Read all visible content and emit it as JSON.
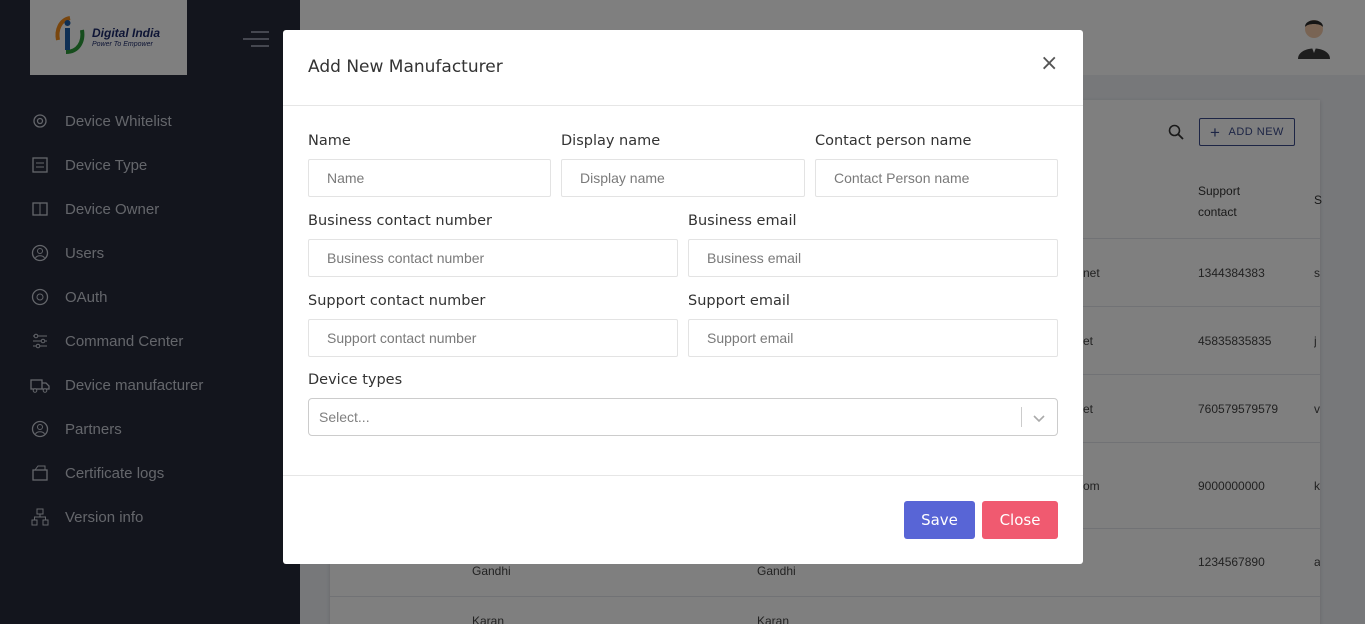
{
  "logo": {
    "title": "Digital India",
    "subtitle": "Power To Empower"
  },
  "sidebar": {
    "items": [
      {
        "label": "Device Whitelist",
        "icon": "gear-icon"
      },
      {
        "label": "Device Type",
        "icon": "list-icon"
      },
      {
        "label": "Device Owner",
        "icon": "book-icon"
      },
      {
        "label": "Users",
        "icon": "user-icon"
      },
      {
        "label": "OAuth",
        "icon": "target-icon"
      },
      {
        "label": "Command Center",
        "icon": "sliders-icon"
      },
      {
        "label": "Device manufacturer",
        "icon": "truck-icon"
      },
      {
        "label": "Partners",
        "icon": "user-icon"
      },
      {
        "label": "Certificate logs",
        "icon": "box-icon"
      },
      {
        "label": "Version info",
        "icon": "network-icon"
      }
    ]
  },
  "toolbar": {
    "add_new_label": "ADD NEW"
  },
  "table": {
    "header_support_line1": "Support",
    "header_support_line2": "contact",
    "header_s": "S",
    "rows": [
      {
        "email_tail": "net",
        "support": "1344384383",
        "next": "s"
      },
      {
        "email_tail": "et",
        "support": "45835835835",
        "next": "j"
      },
      {
        "email_tail": "et",
        "support": "760579579579",
        "next": "v"
      },
      {
        "email_tail": "om",
        "support": "9000000000",
        "next": "k"
      },
      {
        "email_tail": "",
        "support": "1234567890",
        "next": "a",
        "name": "Gandhi",
        "owner": "Gandhi"
      },
      {
        "name": "Karan",
        "owner": "Karan"
      }
    ]
  },
  "modal": {
    "title": "Add New Manufacturer",
    "fields": {
      "name": {
        "label": "Name",
        "placeholder": "Name",
        "value": ""
      },
      "display_name": {
        "label": "Display name",
        "placeholder": "Display name",
        "value": ""
      },
      "contact_person": {
        "label": "Contact person name",
        "placeholder": "Contact Person name",
        "value": ""
      },
      "business_contact": {
        "label": "Business contact number",
        "placeholder": "Business contact number",
        "value": ""
      },
      "business_email": {
        "label": "Business email",
        "placeholder": "Business email",
        "value": ""
      },
      "support_contact": {
        "label": "Support contact number",
        "placeholder": "Support contact number",
        "value": ""
      },
      "support_email": {
        "label": "Support email",
        "placeholder": "Support email",
        "value": ""
      },
      "device_types": {
        "label": "Device types",
        "placeholder": "Select..."
      }
    },
    "save_label": "Save",
    "close_label": "Close"
  },
  "colors": {
    "sidebar": "#262a3a",
    "save": "#5865d6",
    "close": "#f05a70",
    "accent": "#3a4a8a"
  }
}
